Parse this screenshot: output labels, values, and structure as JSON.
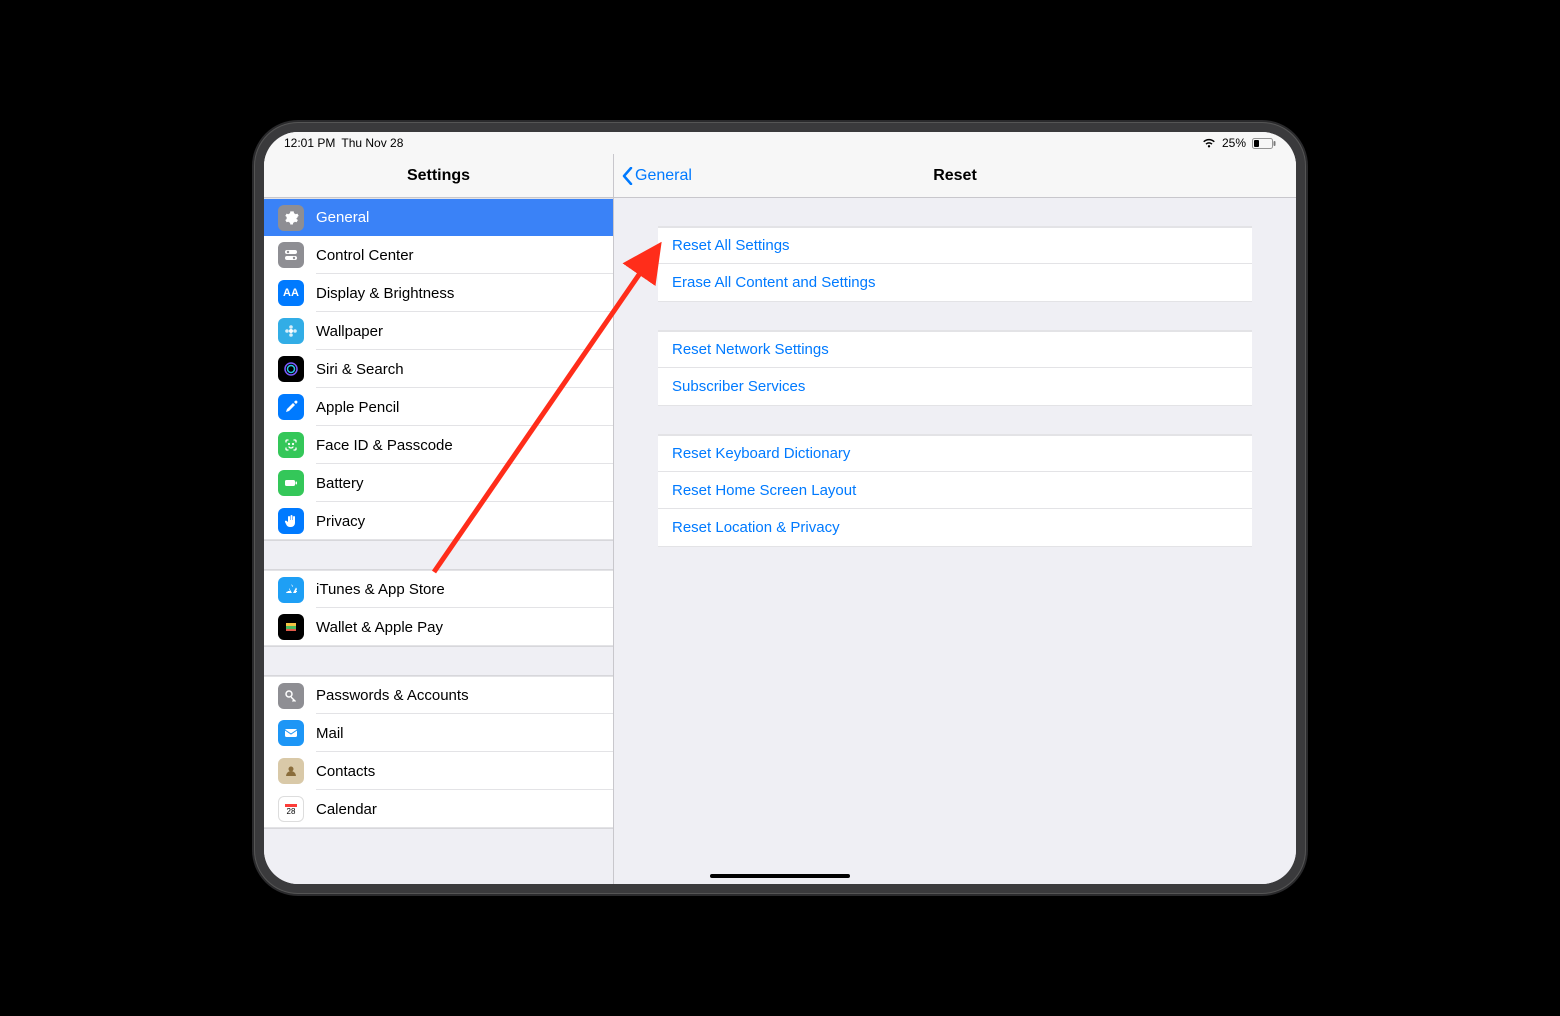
{
  "status": {
    "time": "12:01 PM",
    "date": "Thu Nov 28",
    "battery_pct": "25%"
  },
  "sidebar": {
    "title": "Settings",
    "groups": [
      [
        {
          "label": "General",
          "icon": "gear",
          "selected": true
        },
        {
          "label": "Control Center",
          "icon": "toggles"
        },
        {
          "label": "Display & Brightness",
          "icon": "text-size"
        },
        {
          "label": "Wallpaper",
          "icon": "flower"
        },
        {
          "label": "Siri & Search",
          "icon": "siri"
        },
        {
          "label": "Apple Pencil",
          "icon": "pencil"
        },
        {
          "label": "Face ID & Passcode",
          "icon": "faceid"
        },
        {
          "label": "Battery",
          "icon": "battery"
        },
        {
          "label": "Privacy",
          "icon": "hand"
        }
      ],
      [
        {
          "label": "iTunes & App Store",
          "icon": "appstore"
        },
        {
          "label": "Wallet & Apple Pay",
          "icon": "wallet"
        }
      ],
      [
        {
          "label": "Passwords & Accounts",
          "icon": "key"
        },
        {
          "label": "Mail",
          "icon": "mail"
        },
        {
          "label": "Contacts",
          "icon": "contacts"
        },
        {
          "label": "Calendar",
          "icon": "calendar"
        }
      ]
    ]
  },
  "detail": {
    "back_label": "General",
    "title": "Reset",
    "groups": [
      [
        "Reset All Settings",
        "Erase All Content and Settings"
      ],
      [
        "Reset Network Settings",
        "Subscriber Services"
      ],
      [
        "Reset Keyboard Dictionary",
        "Reset Home Screen Layout",
        "Reset Location & Privacy"
      ]
    ]
  }
}
